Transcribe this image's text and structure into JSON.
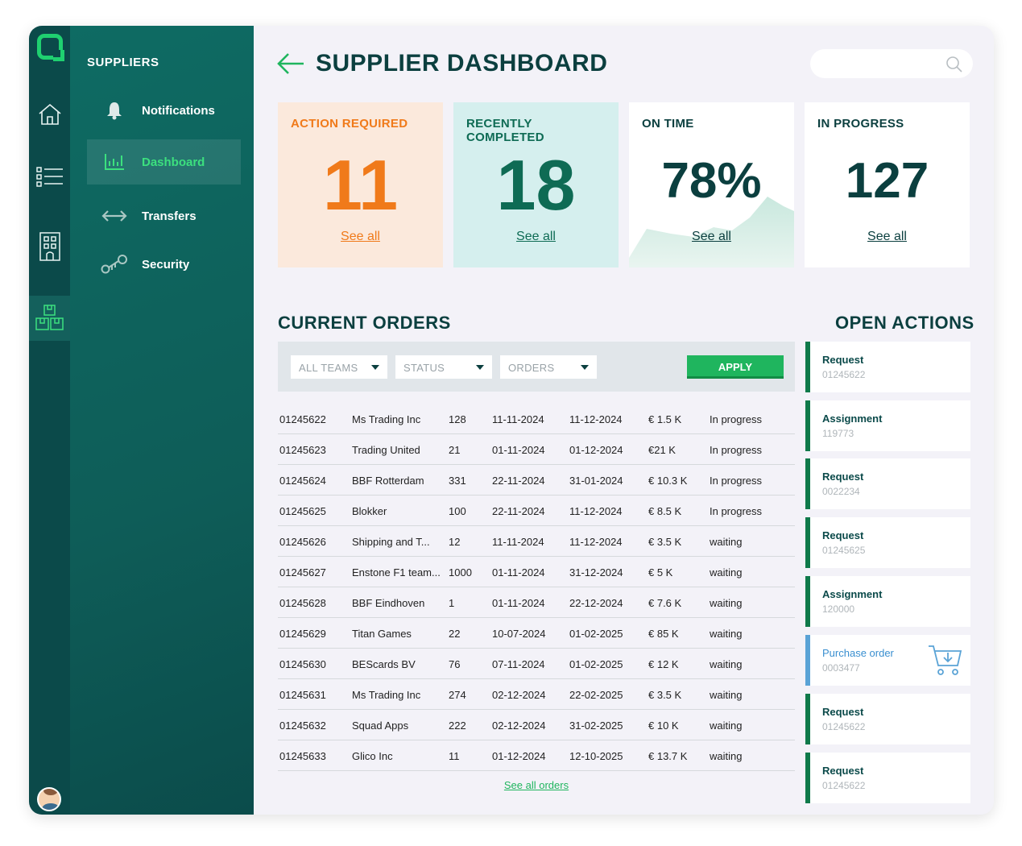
{
  "sidebar": {
    "section_title": "SUPPLIERS",
    "items": [
      {
        "label": "Notifications"
      },
      {
        "label": "Dashboard"
      },
      {
        "label": "Transfers"
      },
      {
        "label": "Security"
      }
    ]
  },
  "header": {
    "title": "SUPPLIER DASHBOARD",
    "search_placeholder": ""
  },
  "stats": [
    {
      "label": "ACTION REQUIRED",
      "value": "11",
      "link": "See all"
    },
    {
      "label": "RECENTLY COMPLETED",
      "value": "18",
      "link": "See all"
    },
    {
      "label": "ON TIME",
      "value": "78%",
      "link": "See all"
    },
    {
      "label": "IN PROGRESS",
      "value": "127",
      "link": "See all"
    }
  ],
  "orders": {
    "title": "CURRENT ORDERS",
    "filters": {
      "teams": "ALL TEAMS",
      "status": "STATUS",
      "orders": "ORDERS",
      "apply": "APPLY"
    },
    "rows": [
      [
        "01245622",
        "Ms Trading Inc",
        "128",
        "11-11-2024",
        "11-12-2024",
        "€ 1.5 K",
        "In progress"
      ],
      [
        "01245623",
        "Trading United",
        "21",
        "01-11-2024",
        "01-12-2024",
        "€21 K",
        "In progress"
      ],
      [
        "01245624",
        "BBF Rotterdam",
        "331",
        "22-11-2024",
        "31-01-2024",
        "€ 10.3 K",
        "In progress"
      ],
      [
        "01245625",
        "Blokker",
        "100",
        "22-11-2024",
        "11-12-2024",
        "€ 8.5 K",
        "In progress"
      ],
      [
        "01245626",
        "Shipping and T...",
        "12",
        "11-11-2024",
        "11-12-2024",
        "€ 3.5 K",
        "waiting"
      ],
      [
        "01245627",
        "Enstone F1 team...",
        "1000",
        "01-11-2024",
        "31-12-2024",
        "€ 5 K",
        "waiting"
      ],
      [
        "01245628",
        "BBF Eindhoven",
        "1",
        "01-11-2024",
        "22-12-2024",
        "€ 7.6 K",
        "waiting"
      ],
      [
        "01245629",
        "Titan Games",
        "22",
        "10-07-2024",
        "01-02-2025",
        "€ 85 K",
        "waiting"
      ],
      [
        "01245630",
        "BEScards BV",
        "76",
        "07-11-2024",
        "01-02-2025",
        "€ 12 K",
        "waiting"
      ],
      [
        "01245631",
        "Ms Trading Inc",
        "274",
        "02-12-2024",
        "22-02-2025",
        "€ 3.5 K",
        "waiting"
      ],
      [
        "01245632",
        "Squad Apps",
        "222",
        "02-12-2024",
        "31-02-2025",
        "€ 10 K",
        "waiting"
      ],
      [
        "01245633",
        "Glico Inc",
        "11",
        "01-12-2024",
        "12-10-2025",
        "€ 13.7 K",
        "waiting"
      ]
    ],
    "see_all": "See all orders"
  },
  "open_actions": {
    "title": "OPEN ACTIONS",
    "items": [
      {
        "type": "Request",
        "id": "01245622"
      },
      {
        "type": "Assignment",
        "id": "119773"
      },
      {
        "type": "Request",
        "id": "0022234"
      },
      {
        "type": "Request",
        "id": "01245625"
      },
      {
        "type": "Assignment",
        "id": "120000"
      },
      {
        "type": "Purchase order",
        "id": "0003477",
        "icon": "cart-download-icon"
      },
      {
        "type": "Request",
        "id": "01245622"
      },
      {
        "type": "Request",
        "id": "01245622"
      }
    ]
  },
  "colors": {
    "accent_green": "#1fb55e",
    "dark_teal": "#0b4a4a",
    "orange": "#f07a1a",
    "action_card_bg": "#fbe9dc",
    "completed_card_bg": "#d5efee"
  }
}
